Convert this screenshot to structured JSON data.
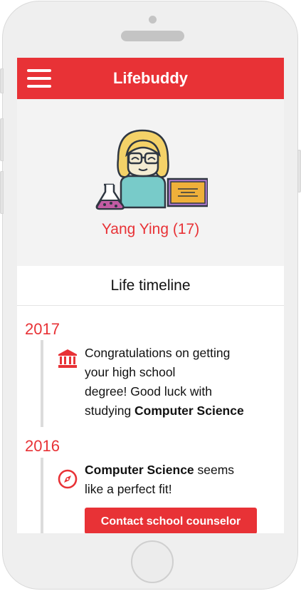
{
  "app": {
    "title": "Lifebuddy"
  },
  "profile": {
    "name": "Yang Ying (17)"
  },
  "timeline": {
    "title": "Life timeline",
    "entries": [
      {
        "year": "2017",
        "icon": "institution-icon",
        "text_line1": "Congratulations on getting",
        "text_line2": "your high school",
        "text_line3": "degree! Good luck with",
        "text_line4_prefix": "studying ",
        "text_line4_bold": "Computer Science"
      },
      {
        "year": "2016",
        "icon": "compass-icon",
        "text_bold": "Computer Science",
        "text_line1_suffix": " seems",
        "text_line2": "like a perfect fit!",
        "button_label": "Contact school counselor"
      }
    ]
  },
  "colors": {
    "accent": "#e83236",
    "background": "#f3f3f3"
  }
}
